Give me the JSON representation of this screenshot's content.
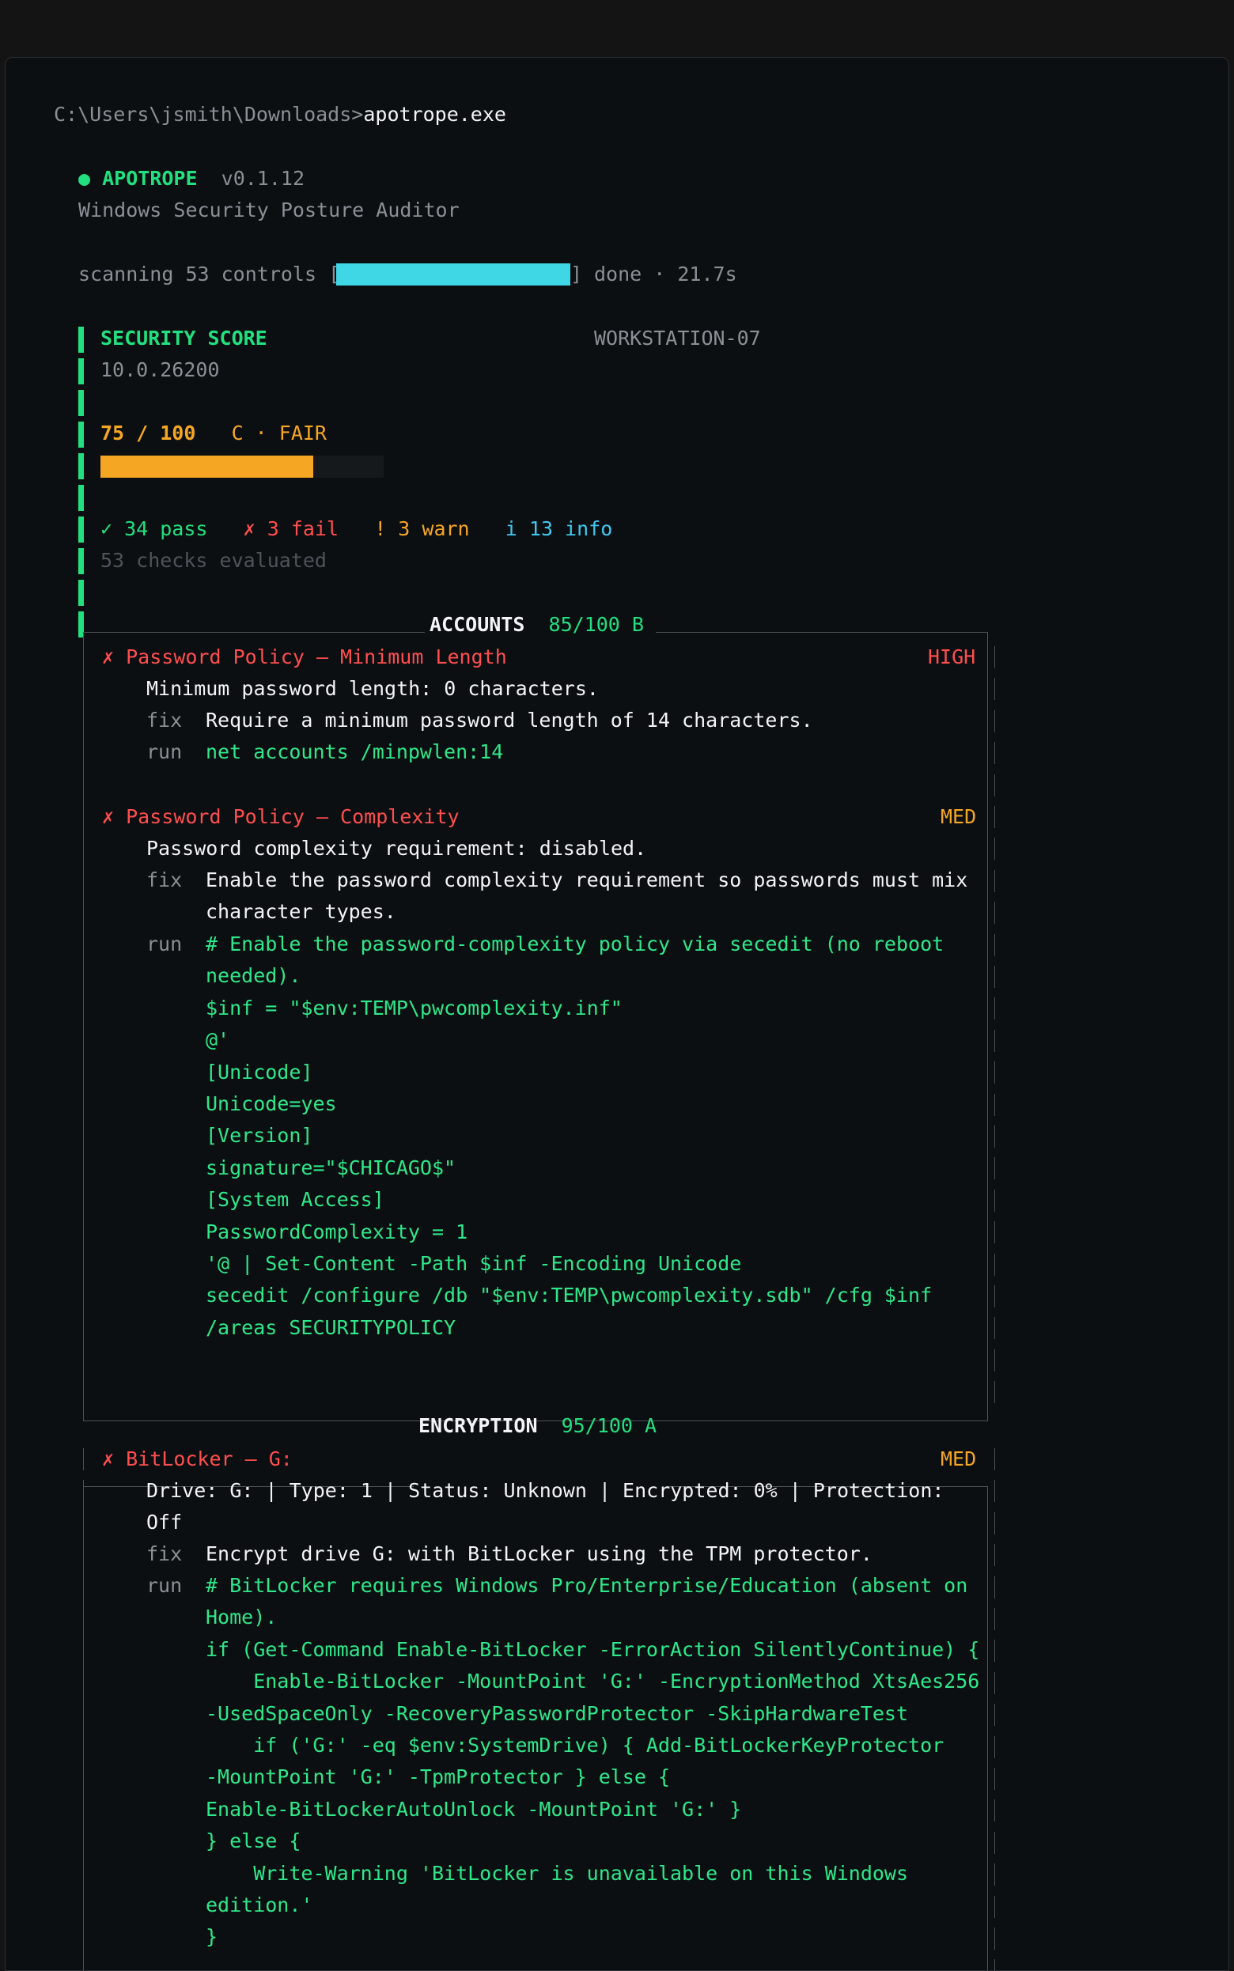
{
  "prompt": {
    "path": "C:\\Users\\jsmith\\Downloads>",
    "command": "apotrope.exe"
  },
  "header": {
    "dot": "●",
    "name": "APOTROPE",
    "version": "v0.1.12",
    "subtitle": "Windows Security Posture Auditor"
  },
  "scan": {
    "label": "scanning 53 controls [",
    "close": "]",
    "status": "done · 21.7s",
    "progress": 1.0
  },
  "score": {
    "title": "SECURITY SCORE",
    "host": "WORKSTATION-07",
    "os_version": "10.0.26200",
    "value": "75 / 100",
    "grade": "C · FAIR",
    "fraction": 0.75,
    "pass": "✓ 34 pass",
    "fail": "✗ 3 fail",
    "warn": "! 3 warn",
    "info_icon": "i",
    "info_text": "13 info",
    "evaluated": "53 checks evaluated"
  },
  "colors": {
    "accent": "#22e07f",
    "fail": "#ff4e4e",
    "warn": "#f5a623",
    "info": "#3fc8ee"
  },
  "accounts": {
    "title": "ACCOUNTS",
    "score": "85/100 B",
    "f1": {
      "mark": "✗",
      "title": "Password Policy — Minimum Length",
      "severity": "HIGH",
      "detail": "Minimum password length: 0 characters.",
      "fix_label": "fix",
      "fix": "Require a minimum password length of 14 characters.",
      "run_label": "run",
      "run": "net accounts /minpwlen:14"
    },
    "f2": {
      "mark": "✗",
      "title": "Password Policy — Complexity",
      "severity": "MED",
      "detail": "Password complexity requirement: disabled.",
      "fix_label": "fix",
      "fix1": "Enable the password complexity requirement so passwords must mix",
      "fix2": "character types.",
      "run_label": "run",
      "code": [
        "# Enable the password-complexity policy via secedit (no reboot",
        "needed).",
        "$inf = \"$env:TEMP\\pwcomplexity.inf\"",
        "@'",
        "[Unicode]",
        "Unicode=yes",
        "[Version]",
        "signature=\"$CHICAGO$\"",
        "[System Access]",
        "PasswordComplexity = 1",
        "'@ | Set-Content -Path $inf -Encoding Unicode",
        "secedit /configure /db \"$env:TEMP\\pwcomplexity.sdb\" /cfg $inf",
        "/areas SECURITYPOLICY"
      ]
    }
  },
  "encryption": {
    "title": "ENCRYPTION",
    "score": "95/100 A",
    "f1": {
      "mark": "✗",
      "title": "BitLocker — G:",
      "severity": "MED",
      "detail1": "Drive: G: | Type: 1 | Status: Unknown | Encrypted: 0% | Protection:",
      "detail2": "Off",
      "fix_label": "fix",
      "fix": "Encrypt drive G: with BitLocker using the TPM protector.",
      "run_label": "run",
      "code": [
        "# BitLocker requires Windows Pro/Enterprise/Education (absent on",
        "Home).",
        "if (Get-Command Enable-BitLocker -ErrorAction SilentlyContinue) {",
        "    Enable-BitLocker -MountPoint 'G:' -EncryptionMethod XtsAes256",
        "-UsedSpaceOnly -RecoveryPasswordProtector -SkipHardwareTest",
        "    if ('G:' -eq $env:SystemDrive) { Add-BitLockerKeyProtector",
        "-MountPoint 'G:' -TpmProtector } else {",
        "Enable-BitLockerAutoUnlock -MountPoint 'G:' }",
        "} else {",
        "    Write-Warning 'BitLocker is unavailable on this Windows",
        "edition.'",
        "}"
      ]
    }
  }
}
